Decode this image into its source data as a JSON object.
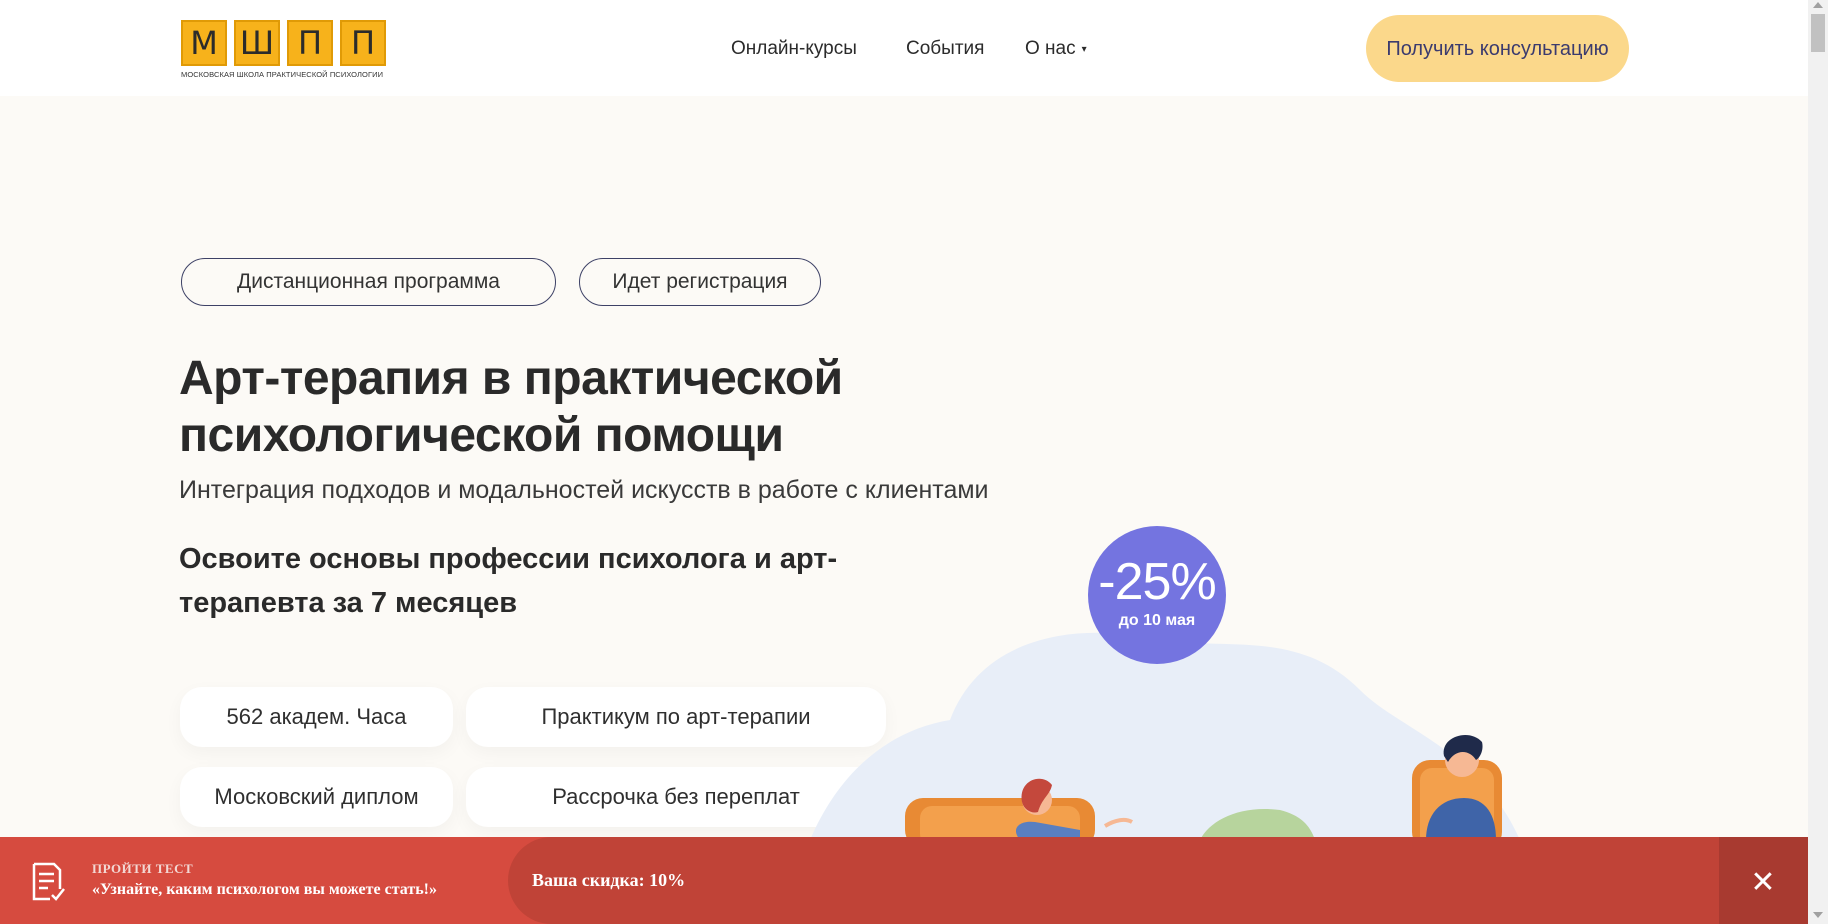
{
  "header": {
    "logo": {
      "letters": [
        "М",
        "Ш",
        "П",
        "П"
      ],
      "caption": "МОСКОВСКАЯ ШКОЛА ПРАКТИЧЕСКОЙ ПСИХОЛОГИИ"
    },
    "nav": [
      {
        "label": "Онлайн-курсы"
      },
      {
        "label": "События"
      },
      {
        "label": "О нас",
        "caret": "▾"
      }
    ],
    "cta_label": "Получить консультацию"
  },
  "hero": {
    "tags": [
      "Дистанционная программа",
      "Идет регистрация"
    ],
    "title": "Арт-терапия в практической психологической помощи",
    "subtitle": "Интеграция подходов и модальностей искусств в работе с клиентами",
    "lead": "Освоите основы профессии психолога и арт-терапевта за 7 месяцев",
    "features": [
      "562 академ. Часа",
      "Практикум по арт-терапии",
      "Московский диплом",
      "Рассрочка без переплат"
    ],
    "discount": {
      "value": "-25%",
      "until": "до 10 мая"
    }
  },
  "banner": {
    "label": "ПРОЙТИ ТЕСТ",
    "text": "«Узнайте, каким психологом вы можете стать!»",
    "discount": "Ваша скидка: 10%",
    "close": "✕"
  },
  "colors": {
    "accent_yellow": "#f7b21b",
    "cta_bg": "#fbd88b",
    "discount_bg": "#7474e0",
    "banner_bg": "#d64b3f",
    "page_bg": "#fcfaf6"
  },
  "icons": [
    "test-checklist-icon",
    "close-icon",
    "chevron-down-icon"
  ]
}
